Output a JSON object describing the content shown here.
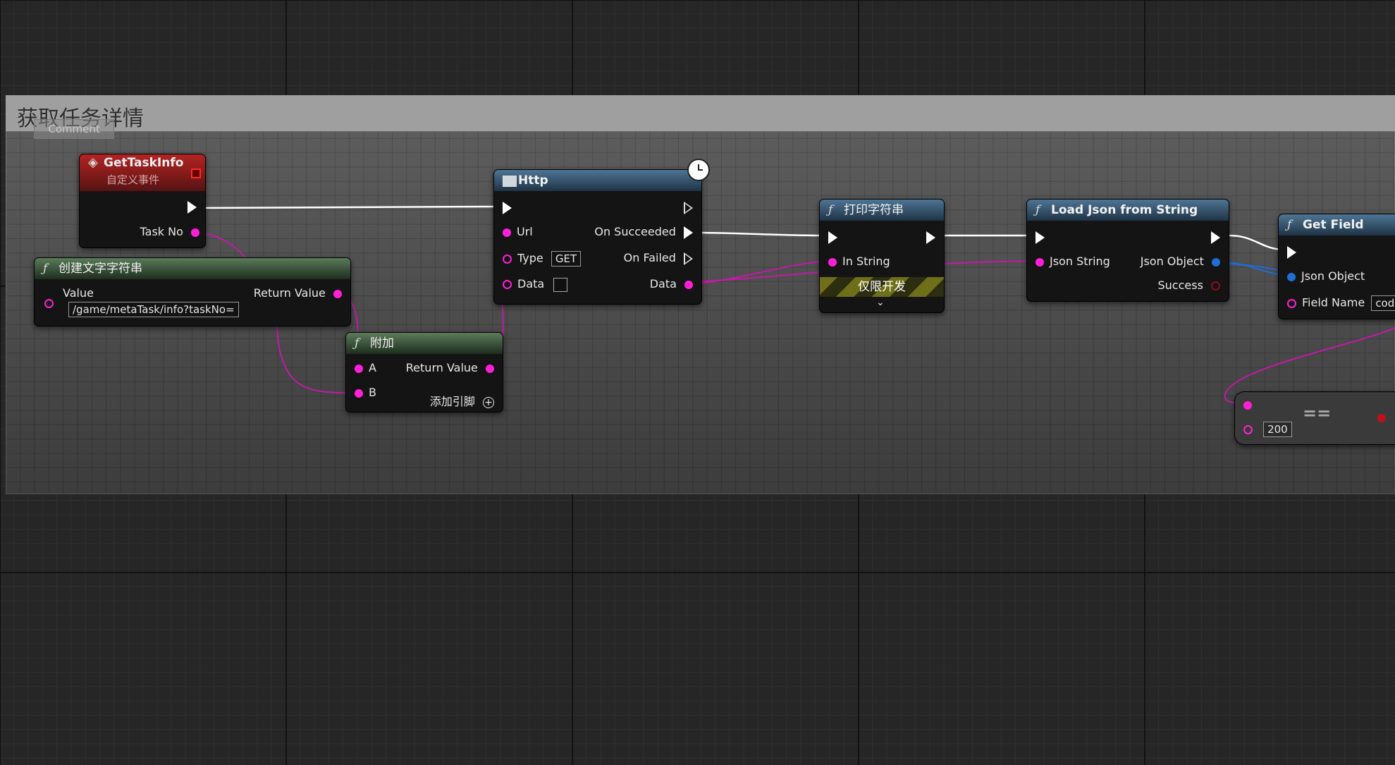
{
  "comment": {
    "title": "获取任务详情",
    "tag": "Comment"
  },
  "nodes": {
    "get_task_info": {
      "title": "GetTaskInfo",
      "subtitle": "自定义事件",
      "pin_task_no": "Task No"
    },
    "make_literal_string": {
      "title": "创建文字字符串",
      "pin_value": "Value",
      "pin_return": "Return Value",
      "value_field": "/game/metaTask/info?taskNo="
    },
    "append": {
      "title": "附加",
      "pin_a": "A",
      "pin_b": "B",
      "pin_return": "Return Value",
      "add_pin": "添加引脚"
    },
    "http": {
      "title": "Http",
      "pin_url": "Url",
      "pin_type": "Type",
      "type_value": "GET",
      "pin_data": "Data",
      "pin_on_succeeded": "On Succeeded",
      "pin_on_failed": "On Failed",
      "pin_data_out": "Data"
    },
    "print_string": {
      "title": "打印字符串",
      "pin_in_string": "In String",
      "dev_only": "仅限开发",
      "expand_icon": "chevron-down-icon"
    },
    "load_json": {
      "title": "Load Json from String",
      "pin_json_string": "Json String",
      "pin_json_object": "Json Object",
      "pin_success": "Success"
    },
    "get_field": {
      "title": "Get Field",
      "pin_json_object": "Json Object",
      "pin_field_name": "Field Name",
      "field_name_value": "code"
    },
    "equal": {
      "operator": "==",
      "value_b": "200"
    }
  },
  "colors": {
    "string_pin": "#ff1fd8",
    "object_pin": "#1e6ed6",
    "bool_pin": "#8a0d1a",
    "exec_wire": "#ffffff"
  }
}
